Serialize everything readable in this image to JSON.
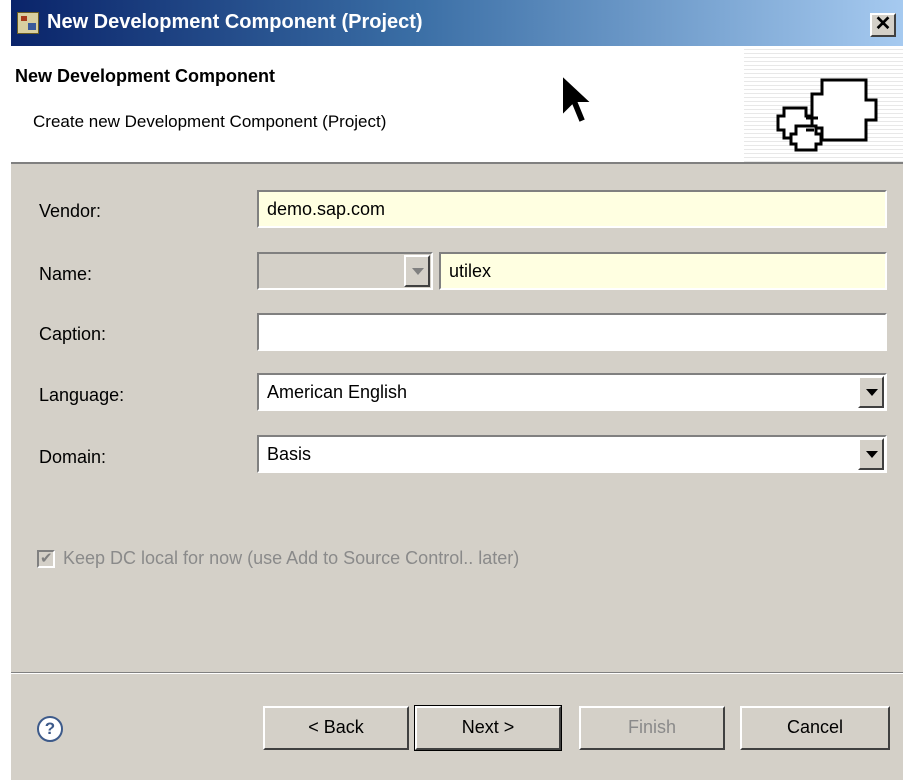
{
  "window": {
    "title": "New Development Component (Project)",
    "close_glyph": "✕"
  },
  "header": {
    "title": "New Development Component",
    "description": "Create new Development Component (Project)"
  },
  "form": {
    "vendor": {
      "label": "Vendor:",
      "value": "demo.sap.com"
    },
    "name": {
      "label": "Name:",
      "prefix_value": "",
      "value": "utilex"
    },
    "caption": {
      "label": "Caption:",
      "value": ""
    },
    "language": {
      "label": "Language:",
      "value": "American English"
    },
    "domain": {
      "label": "Domain:",
      "value": "Basis"
    },
    "keep_local": {
      "label": "Keep DC local for now (use Add to Source Control.. later)",
      "checked": true,
      "enabled": false
    }
  },
  "buttons": {
    "back": "< Back",
    "next": "Next >",
    "finish": "Finish",
    "cancel": "Cancel",
    "help": "?"
  },
  "icons": [
    "app-icon",
    "close-icon",
    "components-graphic",
    "mouse-cursor-icon",
    "help-icon",
    "dropdown-arrow-icon"
  ],
  "colors": {
    "titlebar_start": "#0a246a",
    "titlebar_end": "#a6caf0",
    "required_field": "#ffffe1",
    "dialog_bg": "#d4d0c8"
  }
}
